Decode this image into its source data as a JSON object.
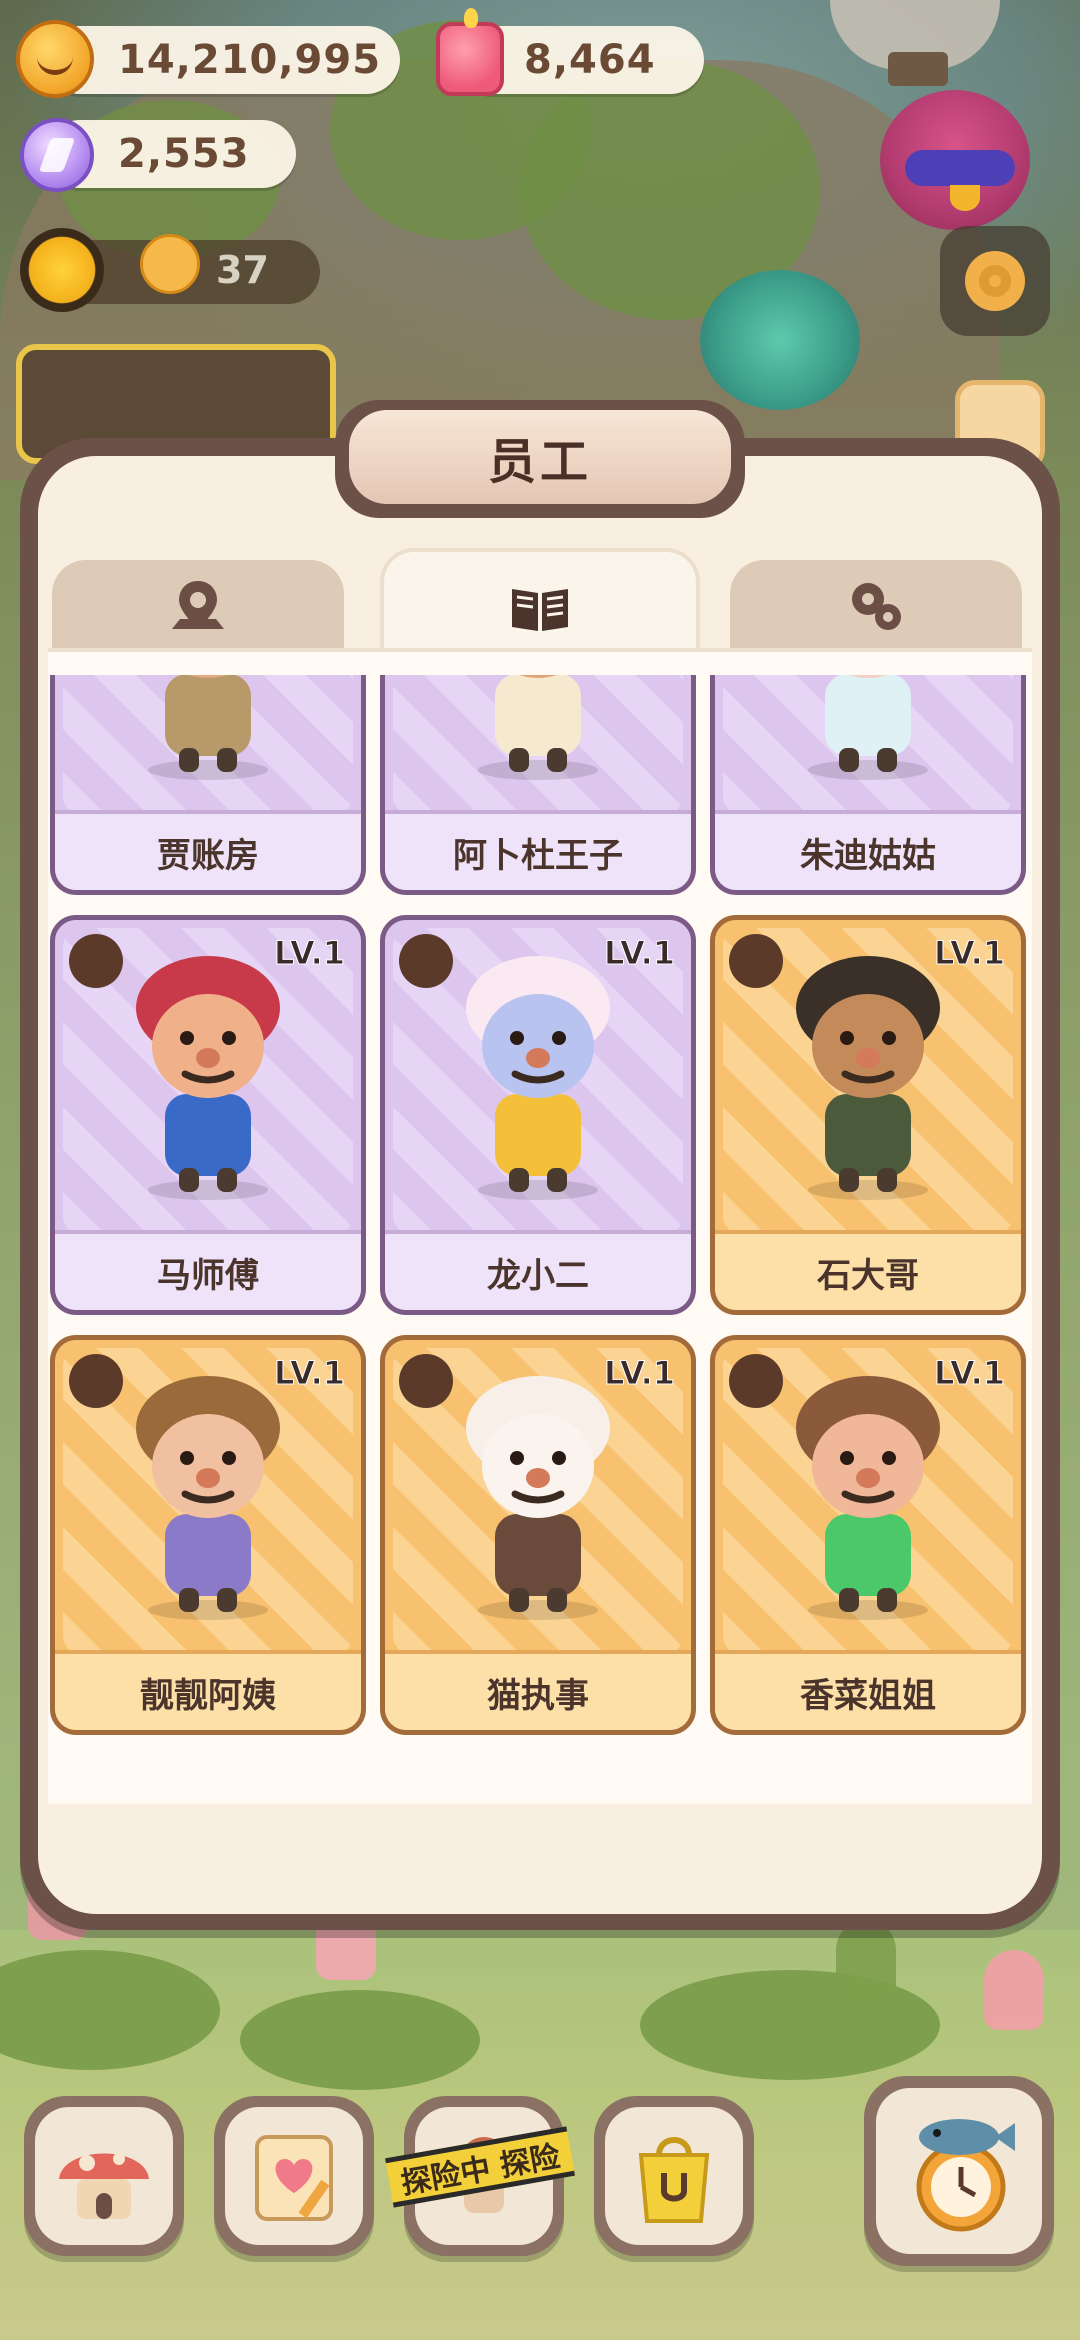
{
  "currency": {
    "cookies": "14,210,995",
    "candles": "8,464",
    "gems": "2,553",
    "staff_count": "37"
  },
  "panel": {
    "title": "员工",
    "tabs": [
      {
        "icon": "map-pin-icon",
        "active": false
      },
      {
        "icon": "open-book-icon",
        "active": true
      },
      {
        "icon": "gears-icon",
        "active": false
      }
    ]
  },
  "staff": [
    {
      "name": "贾账房",
      "level": "",
      "rarity": "purple",
      "hair": "#9b7a86",
      "skin": "#e8a882",
      "outfit": "#b89a6a"
    },
    {
      "name": "阿卜杜王子",
      "level": "",
      "rarity": "purple",
      "hair": "#f4e6c0",
      "skin": "#e0a478",
      "outfit": "#f5ead0"
    },
    {
      "name": "朱迪姑姑",
      "level": "",
      "rarity": "purple",
      "hair": "#2a3a6e",
      "skin": "#f4d0c4",
      "outfit": "#dff1f4"
    },
    {
      "name": "马师傅",
      "level": "LV.1",
      "rarity": "purple",
      "hair": "#c83a4a",
      "skin": "#f0b08a",
      "outfit": "#3a6ac8"
    },
    {
      "name": "龙小二",
      "level": "LV.1",
      "rarity": "purple",
      "hair": "#fbe9f2",
      "skin": "#b9c3ef",
      "outfit": "#f4c03a"
    },
    {
      "name": "石大哥",
      "level": "LV.1",
      "rarity": "orange",
      "hair": "#3a3028",
      "skin": "#c58a5a",
      "outfit": "#4a5a3a"
    },
    {
      "name": "靓靓阿姨",
      "level": "LV.1",
      "rarity": "orange",
      "hair": "#9a6a3a",
      "skin": "#f0c0a0",
      "outfit": "#8a7ac8"
    },
    {
      "name": "猫执事",
      "level": "LV.1",
      "rarity": "orange",
      "hair": "#f7efe8",
      "skin": "#fbf4ee",
      "outfit": "#6a4a3a"
    },
    {
      "name": "香菜姐姐",
      "level": "LV.1",
      "rarity": "orange",
      "hair": "#8a5a3a",
      "skin": "#f0b898",
      "outfit": "#4ac86a"
    }
  ],
  "bottom_nav": [
    {
      "icon": "mushroom-house-icon"
    },
    {
      "icon": "heart-notebook-icon"
    },
    {
      "icon": "explore-icon",
      "banner": "探险中 探险"
    },
    {
      "icon": "shop-bag-icon"
    },
    {
      "icon": "fish-alarm-icon"
    }
  ]
}
